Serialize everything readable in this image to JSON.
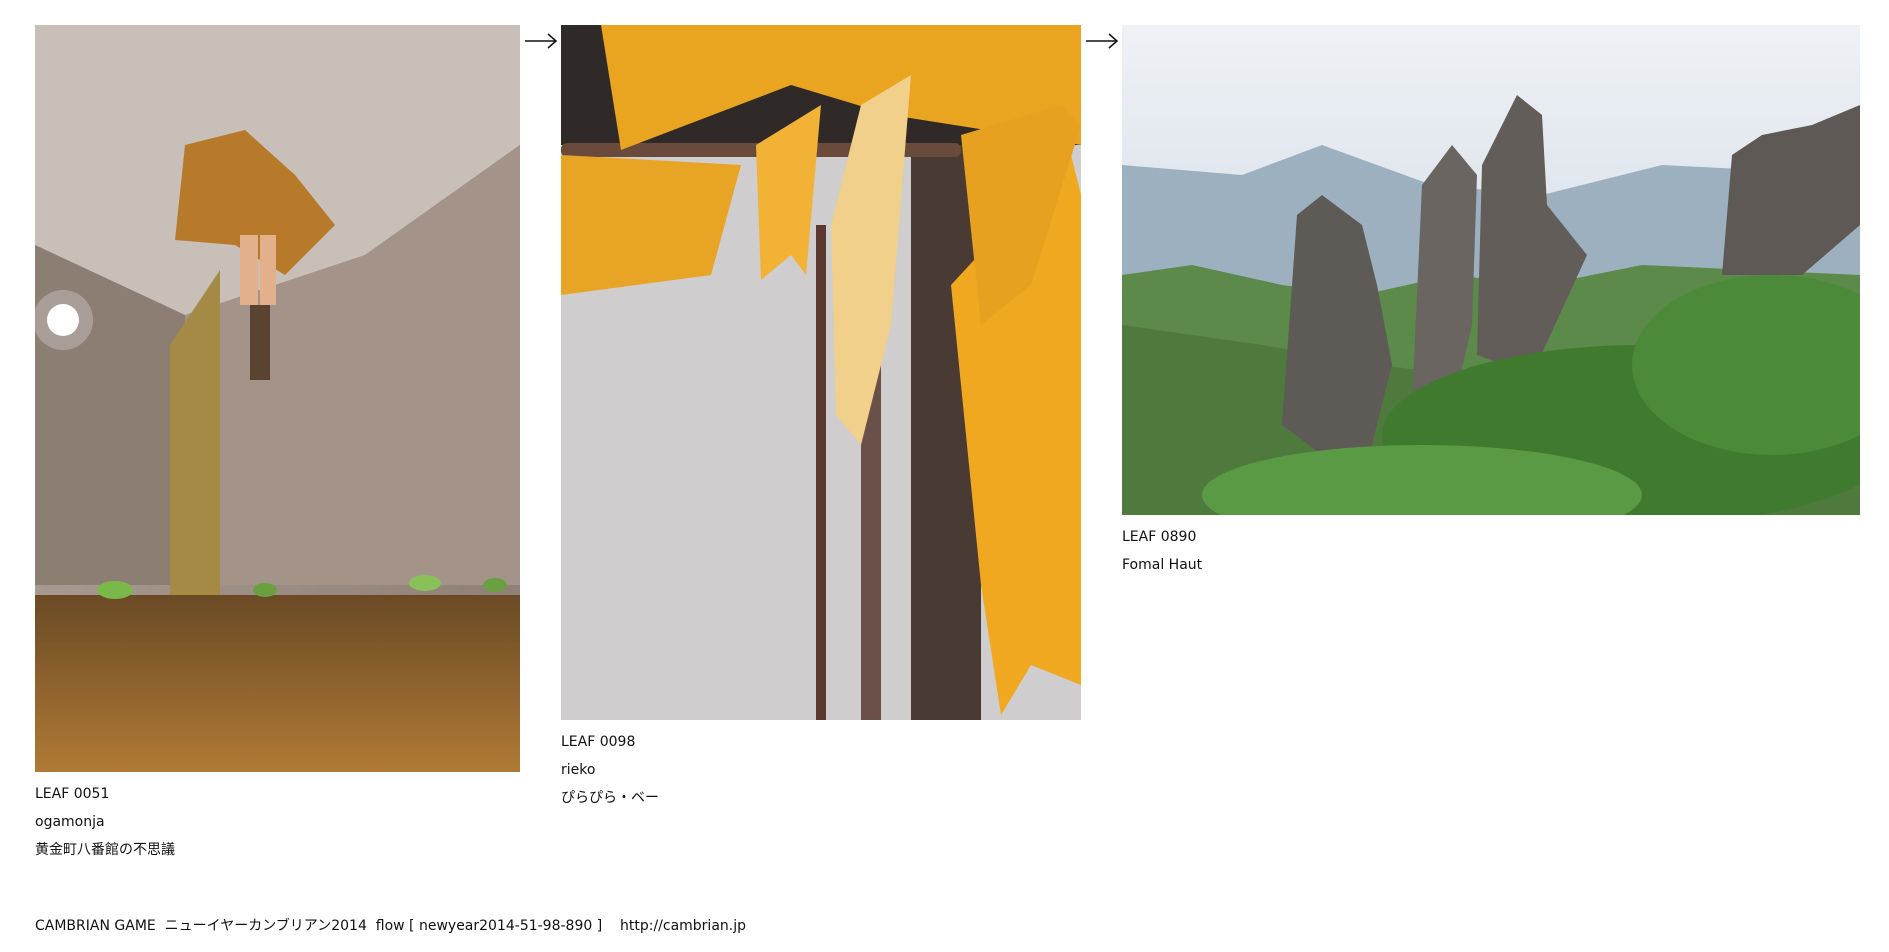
{
  "leaves": [
    {
      "id": "LEAF 0051",
      "author": "ogamonja",
      "title": "黄金町八番館の不思議",
      "image_desc": "doll-hanging-from-ceiling-icon"
    },
    {
      "id": "LEAF 0098",
      "author": "rieko",
      "title": "ぴらぴら・ベー",
      "image_desc": "yellow-torn-cloth-icon"
    },
    {
      "id": "LEAF 0890",
      "author": "Fomal Haut",
      "image_desc": "rock-spires-mountain-icon"
    }
  ],
  "arrows": [
    "right-arrow-icon",
    "right-arrow-icon"
  ],
  "footer": {
    "text": "CAMBRIAN GAME  ニューイヤーカンブリアン2014  flow [ newyear2014-51-98-890 ]    http://cambrian.jp"
  }
}
